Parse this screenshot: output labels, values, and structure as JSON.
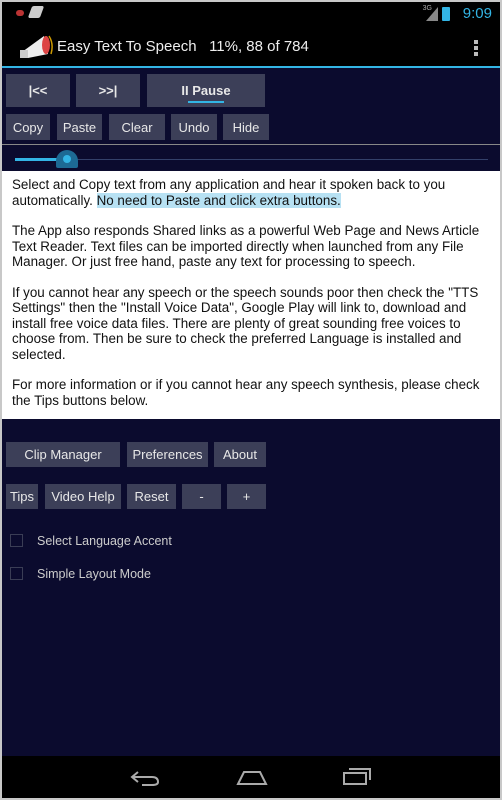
{
  "status_bar": {
    "time": "9:09",
    "network": "3G"
  },
  "action_bar": {
    "app_title": "Easy Text To Speech",
    "progress_text": "11%, 88 of 784"
  },
  "transport": {
    "prev_label": "|<<",
    "next_label": ">>|",
    "pause_label": "II Pause"
  },
  "edit": {
    "copy": "Copy",
    "paste": "Paste",
    "clear": "Clear",
    "undo": "Undo",
    "hide": "Hide"
  },
  "slider": {
    "position_percent": 11
  },
  "text": {
    "p1a": "Select and Copy text from any application and hear it spoken back to you automatically. ",
    "p1b": "No need to Paste and click extra buttons.",
    "p2": "The App also responds Shared links as a powerful Web Page and News Article Text Reader. Text files can be imported directly when launched from any File Manager. Or just free hand, paste any text for processing to speech.",
    "p3": "If you cannot hear any speech or the speech sounds poor then check the \"TTS Settings\" then the \"Install Voice Data\", Google Play will link to, download and install free voice data files. There are plenty of great sounding free voices to choose from. Then be sure to check the preferred Language is installed and selected.",
    "p4": "For more information or if you cannot hear any speech synthesis, please check the Tips buttons below."
  },
  "bottom": {
    "clip_manager": "Clip Manager",
    "preferences": "Preferences",
    "about": "About",
    "tips": "Tips",
    "video_help": "Video Help",
    "reset": "Reset",
    "minus": "-",
    "plus": "+"
  },
  "options": [
    {
      "label": "Select Language Accent",
      "checked": false
    },
    {
      "label": "Simple Layout Mode",
      "checked": false
    }
  ],
  "colors": {
    "accent": "#33b5e5",
    "background": "#0b0b2e",
    "button": "#3c3f58"
  }
}
